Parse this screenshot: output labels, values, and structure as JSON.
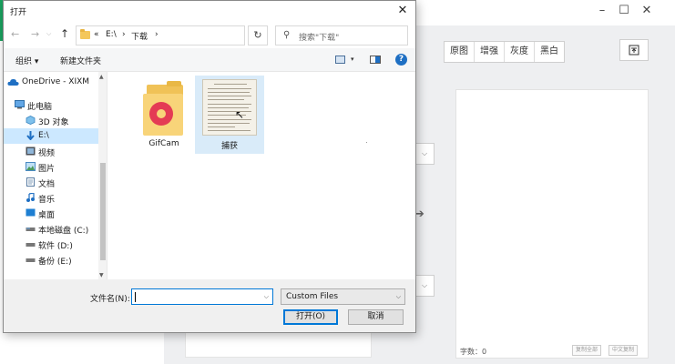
{
  "colors": {
    "accent": "#0078d7",
    "selection": "#cce8ff",
    "folder": "#f4c75a",
    "app_green": "#1aa260"
  },
  "background_app": {
    "window_controls": [
      "minimize-icon",
      "maximize-icon",
      "close-icon"
    ],
    "filters": [
      "原图",
      "增强",
      "灰度",
      "黑白"
    ],
    "upload_icon": "upload-icon",
    "word_count": "字数：0",
    "copy_all": "复制全部",
    "copy_cn": "中文复制"
  },
  "dialog": {
    "title": "打开",
    "close_icon": "close-icon",
    "address": {
      "prefix": "«",
      "drive": "E:\\",
      "sep1": "›",
      "folder": "下载",
      "sep2": "›",
      "chevron": "⌵"
    },
    "search_placeholder": "搜索\"下载\"",
    "toolbar": {
      "organize": "组织 ▾",
      "new_folder": "新建文件夹"
    },
    "nav": [
      {
        "label": "OneDrive - XIXM",
        "icon": "cloud-icon"
      },
      {
        "label": "此电脑",
        "icon": "computer-icon"
      },
      {
        "label": "3D 对象",
        "icon": "cube-icon"
      },
      {
        "label": "E:\\",
        "icon": "download-arrow-icon"
      },
      {
        "label": "视频",
        "icon": "video-icon"
      },
      {
        "label": "图片",
        "icon": "image-icon"
      },
      {
        "label": "文档",
        "icon": "document-icon"
      },
      {
        "label": "音乐",
        "icon": "music-icon"
      },
      {
        "label": "桌面",
        "icon": "desktop-icon"
      },
      {
        "label": "本地磁盘 (C:)",
        "icon": "drive-icon"
      },
      {
        "label": "软件 (D:)",
        "icon": "drive-icon"
      },
      {
        "label": "备份 (E:)",
        "icon": "drive-icon"
      }
    ],
    "files": [
      {
        "name": "GifCam",
        "type": "folder"
      },
      {
        "name": "捕获",
        "type": "image"
      }
    ],
    "filename_label": "文件名(N):",
    "filename_value": "",
    "filetype": "Custom Files",
    "open_button": "打开(O)",
    "cancel_button": "取消"
  }
}
